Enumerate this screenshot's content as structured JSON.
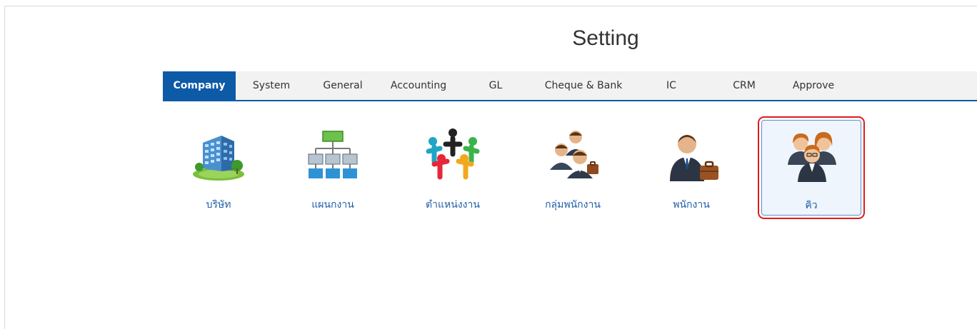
{
  "page": {
    "title": "Setting"
  },
  "tabs": [
    {
      "label": "Company",
      "active": true
    },
    {
      "label": "System"
    },
    {
      "label": "General"
    },
    {
      "label": "Accounting"
    },
    {
      "label": "GL"
    },
    {
      "label": "Cheque & Bank"
    },
    {
      "label": "IC"
    },
    {
      "label": "CRM"
    },
    {
      "label": "Approve"
    }
  ],
  "items": [
    {
      "label": "บริษัท",
      "icon": "building-icon"
    },
    {
      "label": "แผนกงาน",
      "icon": "org-chart-icon"
    },
    {
      "label": "ตำแหน่งงาน",
      "icon": "people-circle-icon"
    },
    {
      "label": "กลุ่มพนักงาน",
      "icon": "employee-group-icon"
    },
    {
      "label": "พนักงาน",
      "icon": "employee-icon"
    },
    {
      "label": "คิว",
      "icon": "team-icon",
      "selected": true
    }
  ],
  "colors": {
    "accent": "#0d5aa7",
    "highlight": "#e01b1b",
    "link": "#1f5fa6"
  }
}
